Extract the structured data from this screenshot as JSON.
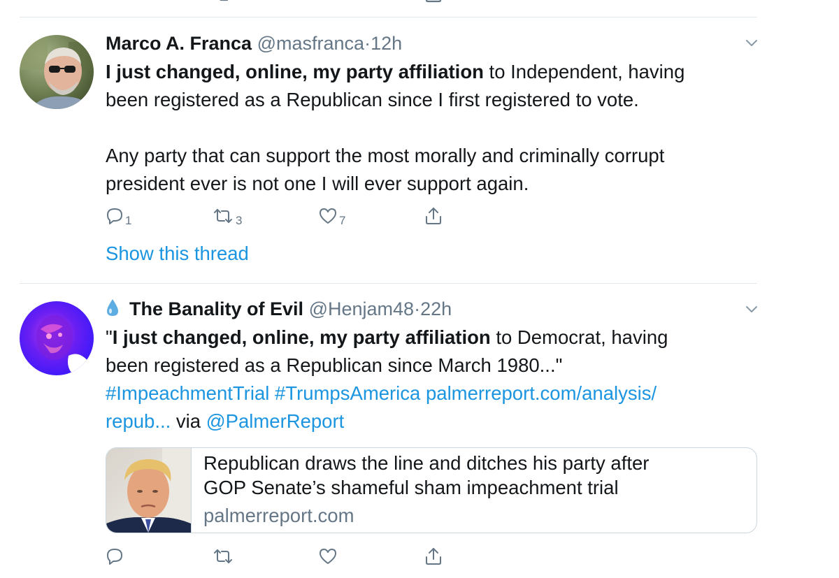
{
  "tweets": [
    {
      "author_name": "Marco A. Franca",
      "handle": "@masfranca",
      "separator": "·",
      "time": "12h",
      "text": {
        "bold_lead": "I just changed, online, my party affiliation",
        "line1_rest": " to Independent, having",
        "line2": "been registered as a Republican since I first registered to vote.",
        "para2_line1": "Any party that can support the most morally and criminally corrupt",
        "para2_line2": "president ever is not one I will ever support again."
      },
      "reply_count": "1",
      "retweet_count": "3",
      "like_count": "7",
      "show_thread_label": "Show this thread"
    },
    {
      "author_name": "The Banality of Evil",
      "handle": "@Henjam48",
      "separator": "·",
      "time": "22h",
      "text": {
        "quote_open": "\"",
        "bold_lead": "I just changed, online, my party affiliation",
        "line1_rest": " to Democrat, having",
        "line2": "been registered as a Republican since March 1980...\"",
        "hashtag1": "#ImpeachmentTrial",
        "hashtag2": "#TrumpsAmerica",
        "link_part1": "palmerreport.com/analysis/",
        "link_part2": "repub...",
        "via_text": " via ",
        "mention": "@PalmerReport"
      },
      "card": {
        "title_line1": "Republican draws the line and ditches his party after",
        "title_line2": "GOP Senate’s shameful sham impeachment trial",
        "domain": "palmerreport.com"
      }
    }
  ],
  "icons": {
    "reply": "reply-icon",
    "retweet": "retweet-icon",
    "like": "heart-icon",
    "share": "share-icon",
    "caret": "chevron-down-icon",
    "emoji": "droplet-icon"
  },
  "colors": {
    "link_blue": "#1b95e0",
    "secondary_gray": "#657786",
    "divider": "#e1e8ed",
    "text": "#14171a"
  }
}
